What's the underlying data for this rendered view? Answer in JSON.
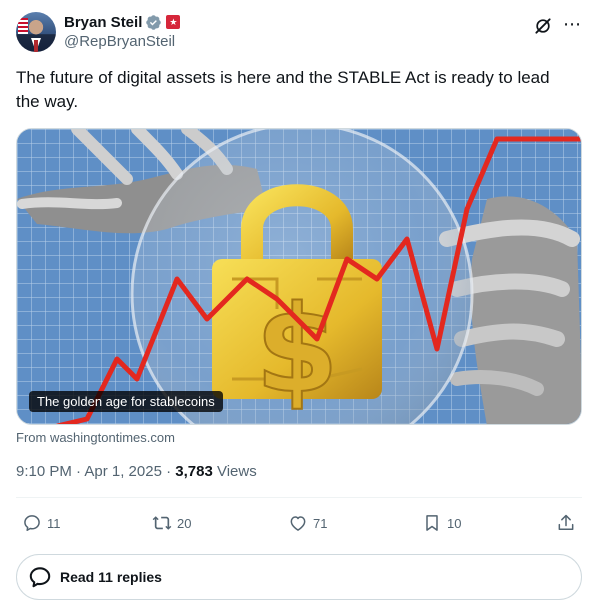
{
  "author": {
    "display_name": "Bryan Steil",
    "handle": "@RepBryanSteil",
    "verified": true,
    "badge": "gov-badge-icon"
  },
  "tweet": {
    "text": "The future of digital assets is here and the STABLE Act is ready to lead the way.",
    "time": "9:10 PM · Apr 1, 2025 · ",
    "views_count": "3,783",
    "views_label": "Views"
  },
  "card": {
    "caption": "The golden age for stablecoins",
    "source": "From washingtontimes.com"
  },
  "actions": {
    "replies": "11",
    "reposts": "20",
    "likes": "71",
    "bookmarks": "10"
  },
  "read_replies": "Read 11 replies",
  "colors": {
    "accent_blue": "#1d9bf0",
    "muted": "#536471",
    "badge_red": "#d6263a"
  }
}
